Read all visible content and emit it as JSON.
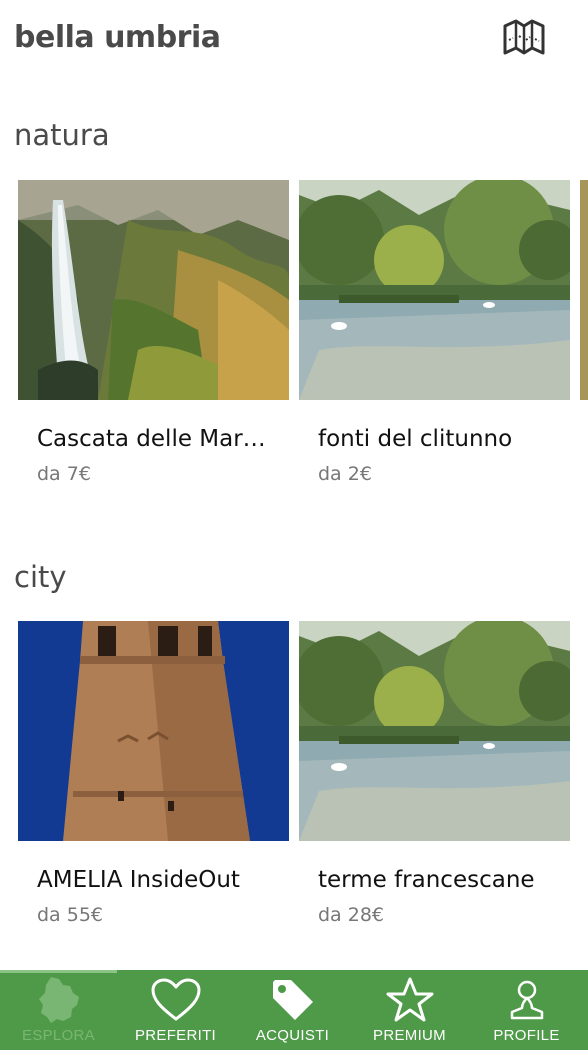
{
  "header": {
    "title": "bella umbria",
    "map_icon": "map-icon"
  },
  "sections": [
    {
      "title": "natura",
      "cards": [
        {
          "name": "Cascata delle Mar…",
          "price": "da 7€",
          "image": "waterfall"
        },
        {
          "name": "fonti del clitunno",
          "price": "da 2€",
          "image": "lake"
        }
      ]
    },
    {
      "title": "city",
      "cards": [
        {
          "name": "AMELIA InsideOut",
          "price": "da 55€",
          "image": "tower"
        },
        {
          "name": "terme francescane",
          "price": "da 28€",
          "image": "lake"
        }
      ]
    }
  ],
  "tabbar": {
    "color": "#4e9a48",
    "tabs": [
      {
        "label": "ESPLORA",
        "icon": "umbria-region-icon",
        "active": true
      },
      {
        "label": "PREFERITI",
        "icon": "heart-icon",
        "active": false
      },
      {
        "label": "ACQUISTI",
        "icon": "tag-icon",
        "active": false
      },
      {
        "label": "PREMIUM",
        "icon": "star-icon",
        "active": false
      },
      {
        "label": "PROFILE",
        "icon": "user-icon",
        "active": false
      }
    ]
  }
}
